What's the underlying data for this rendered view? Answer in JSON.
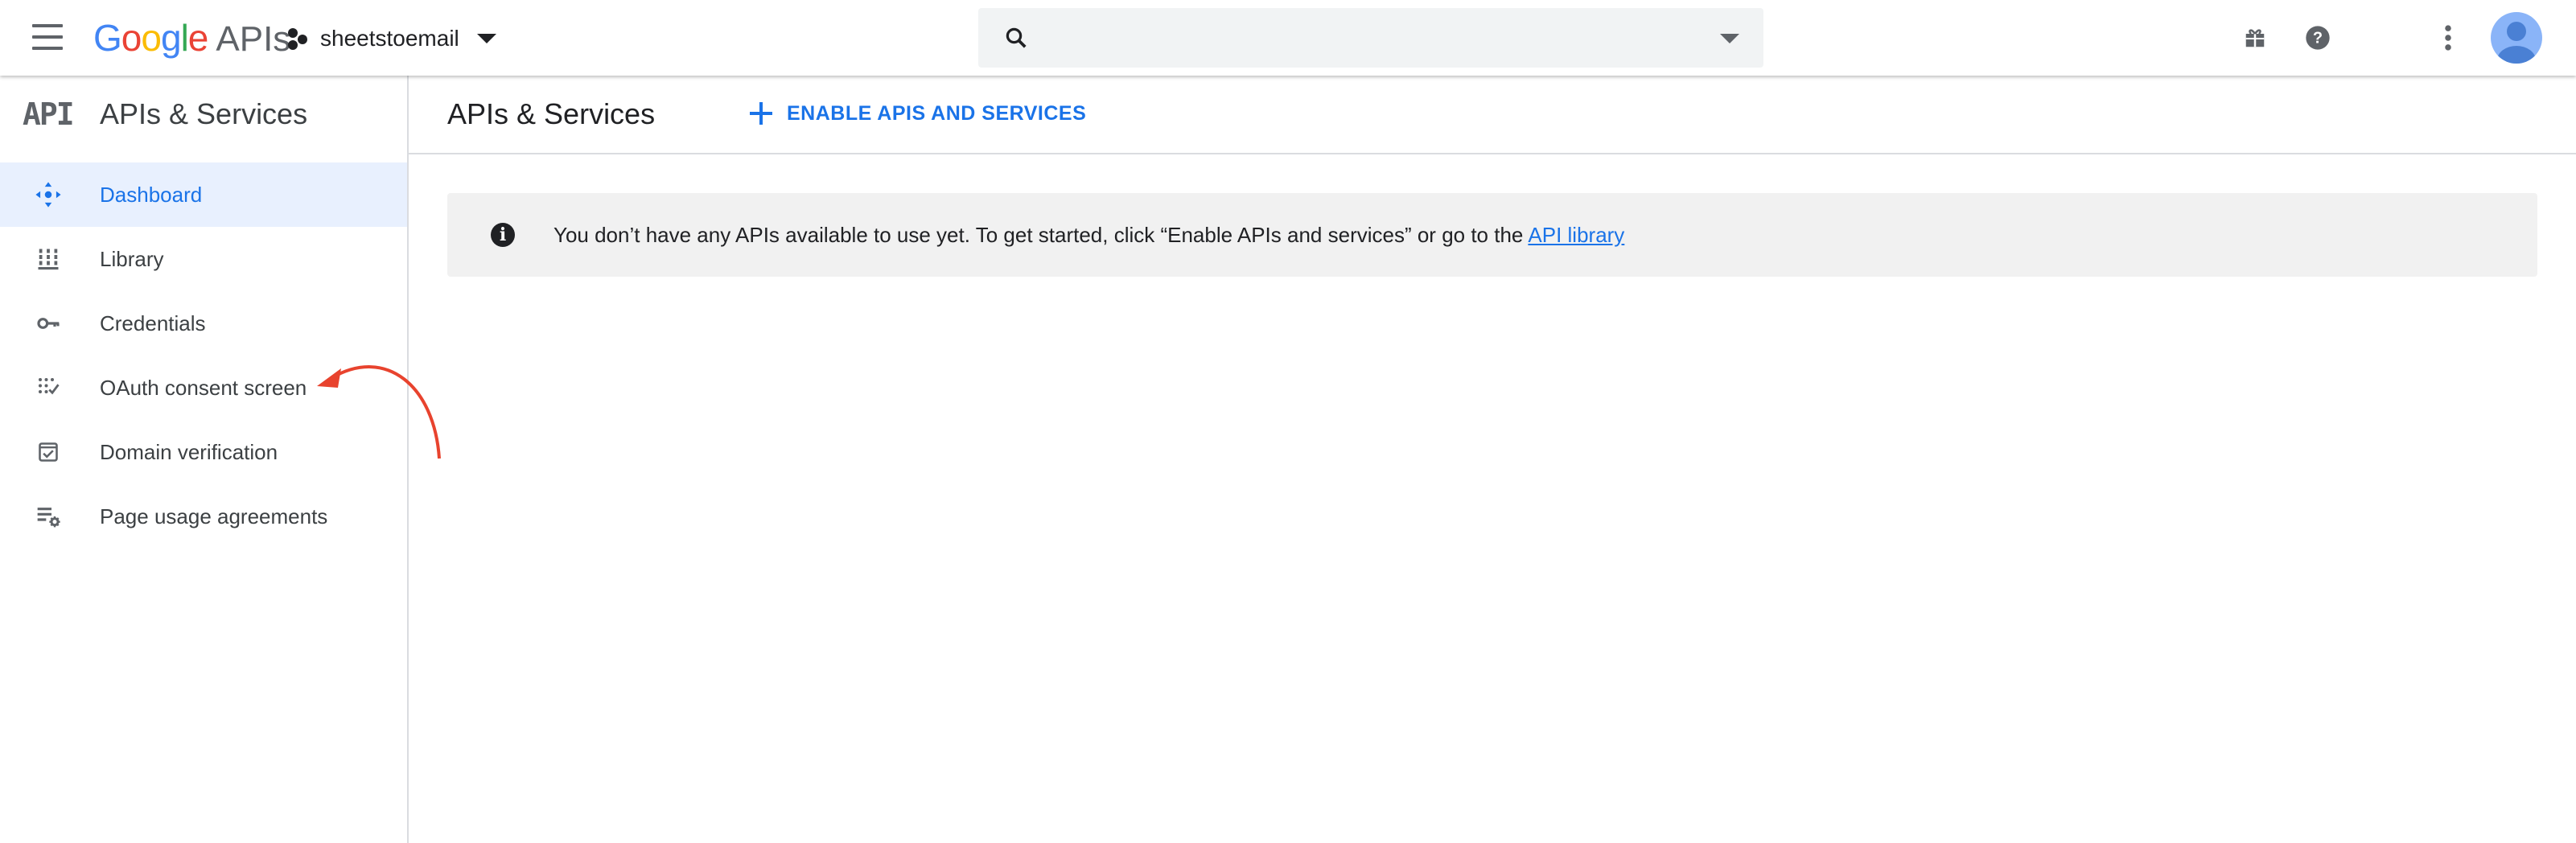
{
  "topbar": {
    "logo": {
      "letters": [
        "G",
        "o",
        "o",
        "g",
        "l",
        "e"
      ],
      "suffix": "APIs"
    },
    "project_name": "sheetstoemail",
    "search": {
      "placeholder": ""
    }
  },
  "sidebar": {
    "product_mark": "API",
    "title": "APIs & Services",
    "items": [
      {
        "label": "Dashboard",
        "icon": "dashboard-icon",
        "active": true
      },
      {
        "label": "Library",
        "icon": "library-icon",
        "active": false
      },
      {
        "label": "Credentials",
        "icon": "key-icon",
        "active": false
      },
      {
        "label": "OAuth consent screen",
        "icon": "oauth-consent-icon",
        "active": false
      },
      {
        "label": "Domain verification",
        "icon": "domain-verification-icon",
        "active": false
      },
      {
        "label": "Page usage agreements",
        "icon": "page-usage-icon",
        "active": false
      }
    ]
  },
  "main": {
    "title": "APIs & Services",
    "enable_button": "ENABLE APIS AND SERVICES",
    "info": {
      "message": "You don’t have any APIs available to use yet. To get started, click “Enable APIs and services” or go to the",
      "link": "API library"
    }
  },
  "colors": {
    "accent": "#1a73e8",
    "active_bg": "#e8f0fe",
    "annotation_arrow": "#e8432e"
  }
}
